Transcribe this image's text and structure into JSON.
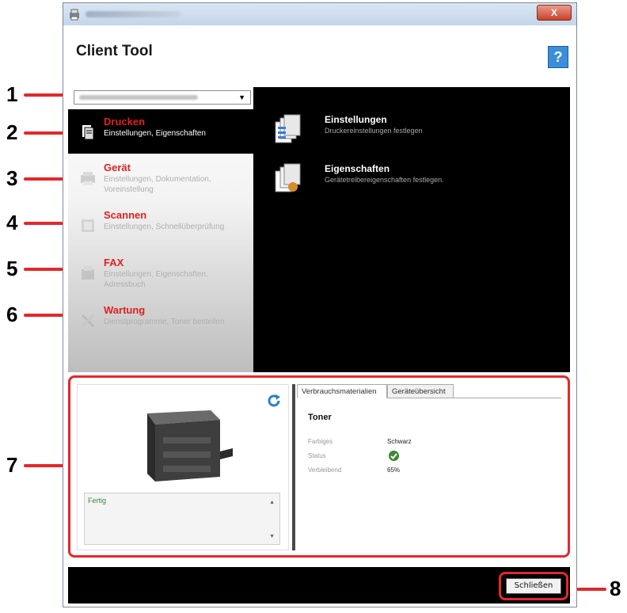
{
  "header": {
    "title": "Client Tool",
    "help_label": "?"
  },
  "window": {
    "close_label": "X"
  },
  "nav": {
    "items": [
      {
        "title": "Drucken",
        "subtitle": "Einstellungen, Eigenschaften",
        "active": true
      },
      {
        "title": "Gerät",
        "subtitle": "Einstellungen, Dokumentation, Voreinstellung"
      },
      {
        "title": "Scannen",
        "subtitle": "Einstellungen, Schnellüberprüfung"
      },
      {
        "title": "FAX",
        "subtitle": "Einstellungen, Eigenschaften, Adressbuch"
      },
      {
        "title": "Wartung",
        "subtitle": "Dienstprogramme, Toner bestellen"
      }
    ]
  },
  "content": {
    "items": [
      {
        "title": "Einstellungen",
        "subtitle": "Druckereinstellungen festlegen"
      },
      {
        "title": "Eigenschaften",
        "subtitle": "Gerätetreibereigenschaften festlegen."
      }
    ]
  },
  "status": {
    "text": "Fertig"
  },
  "tabs": {
    "supplies": "Verbrauchsmaterialien",
    "overview": "Geräteübersicht"
  },
  "toner": {
    "heading": "Toner",
    "color_label": "Farbiges",
    "color_value": "Schwarz",
    "status_label": "Status",
    "remaining_label": "Verbleibend",
    "remaining_value": "65%"
  },
  "footer": {
    "close_label": "Schließen"
  },
  "callouts": [
    "1",
    "2",
    "3",
    "4",
    "5",
    "6",
    "7",
    "8"
  ],
  "colors": {
    "accent": "#e3282b",
    "nav_title": "#e02020"
  }
}
